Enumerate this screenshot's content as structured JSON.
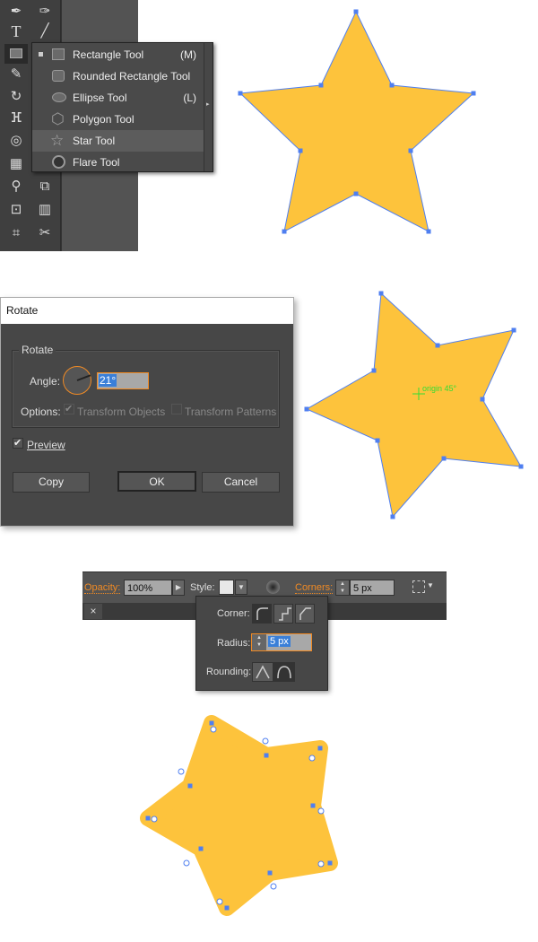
{
  "colors": {
    "star_fill": "#fdc33c",
    "path_stroke": "#4f7ff0",
    "accent": "#f08a24",
    "origin": "#33dd33"
  },
  "toolbox": {
    "tools": [
      "pen-tool",
      "curvature-tool",
      "type-tool",
      "line-tool",
      "rectangle-tool",
      "pencil-tool",
      "rotate-tool",
      "puppet-warp-tool",
      "shape-builder-tool",
      "perspective-grid-tool",
      "eyedropper-tool",
      "blend-tool",
      "symbol-sprayer-tool",
      "column-graph-tool",
      "artboard-tool",
      "slice-tool"
    ]
  },
  "flyout": {
    "items": [
      {
        "label": "Rectangle Tool",
        "shortcut": "(M)",
        "icon": "rectangle-icon",
        "current": true
      },
      {
        "label": "Rounded Rectangle Tool",
        "shortcut": "",
        "icon": "rounded-rectangle-icon"
      },
      {
        "label": "Ellipse Tool",
        "shortcut": "(L)",
        "icon": "ellipse-icon"
      },
      {
        "label": "Polygon Tool",
        "shortcut": "",
        "icon": "polygon-icon"
      },
      {
        "label": "Star Tool",
        "shortcut": "",
        "icon": "star-icon",
        "highlighted": true
      },
      {
        "label": "Flare Tool",
        "shortcut": "",
        "icon": "flare-icon"
      }
    ]
  },
  "rotate_dialog": {
    "title": "Rotate",
    "group": "Rotate",
    "angle_label": "Angle:",
    "angle_value": "21°",
    "options_label": "Options:",
    "transform_objects": "Transform Objects",
    "transform_objects_checked": true,
    "transform_patterns": "Transform Patterns",
    "transform_patterns_checked": false,
    "preview": "Preview",
    "preview_checked": true,
    "copy": "Copy",
    "ok": "OK",
    "cancel": "Cancel"
  },
  "origin_label": "origin 45°",
  "control_bar": {
    "opacity_label": "Opacity:",
    "opacity_value": "100%",
    "style_label": "Style:",
    "corners_label": "Corners:",
    "corners_value": "5 px",
    "close": "×"
  },
  "corner_popup": {
    "corner_label": "Corner:",
    "radius_label": "Radius:",
    "radius_value": "5 px",
    "rounding_label": "Rounding:"
  }
}
